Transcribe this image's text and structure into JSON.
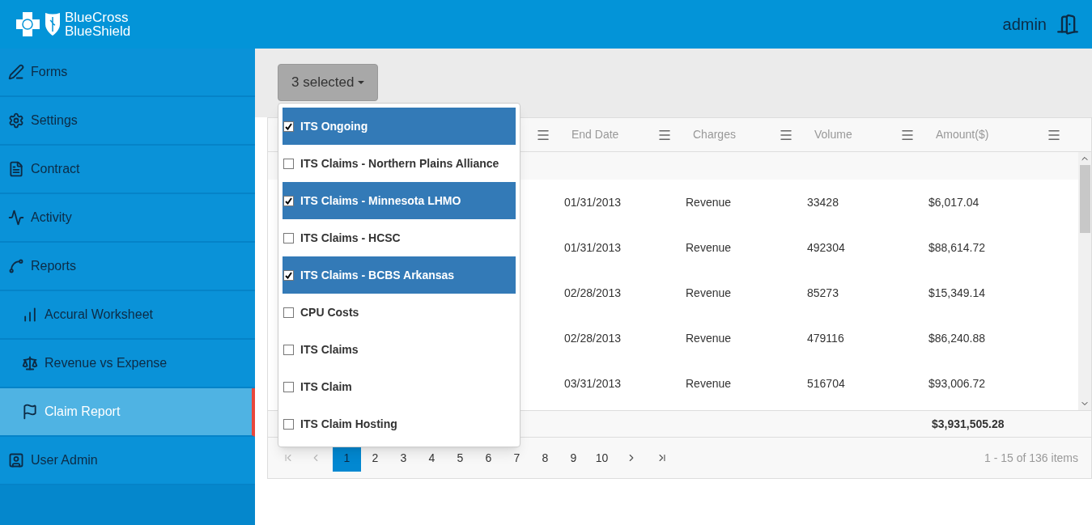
{
  "header": {
    "logo_line1": "BlueCross",
    "logo_line2": "BlueShield",
    "user": "admin"
  },
  "sidebar": {
    "items": [
      {
        "label": "Forms",
        "selected": false
      },
      {
        "label": "Settings",
        "selected": false
      },
      {
        "label": "Contract",
        "selected": false
      },
      {
        "label": "Activity",
        "selected": false
      },
      {
        "label": "Reports",
        "selected": false,
        "children": [
          {
            "label": "Accural Worksheet",
            "selected": false
          },
          {
            "label": "Revenue vs Expense",
            "selected": false
          },
          {
            "label": "Claim Report",
            "selected": true
          }
        ]
      },
      {
        "label": "User Admin",
        "selected": false
      }
    ]
  },
  "filter": {
    "button": "3 selected",
    "expanded": true,
    "options": [
      {
        "label": "ITS Ongoing",
        "checked": true
      },
      {
        "label": "ITS Claims - Northern Plains Alliance",
        "checked": false
      },
      {
        "label": "ITS Claims - Minnesota LHMO",
        "checked": true
      },
      {
        "label": "ITS Claims - HCSC",
        "checked": false
      },
      {
        "label": "ITS Claims - BCBS Arkansas",
        "checked": true
      },
      {
        "label": "CPU Costs",
        "checked": false
      },
      {
        "label": "ITS Claims",
        "checked": false
      },
      {
        "label": "ITS Claim",
        "checked": false
      },
      {
        "label": "ITS Claim Hosting",
        "checked": false
      }
    ]
  },
  "table": {
    "columns": [
      "End Date",
      "Charges",
      "Volume",
      "Amount($)"
    ],
    "rows": [
      [
        "01/31/2013",
        "Revenue",
        "33428",
        "$6,017.04"
      ],
      [
        "01/31/2013",
        "Revenue",
        "492304",
        "$88,614.72"
      ],
      [
        "02/28/2013",
        "Revenue",
        "85273",
        "$15,349.14"
      ],
      [
        "02/28/2013",
        "Revenue",
        "479116",
        "$86,240.88"
      ],
      [
        "03/31/2013",
        "Revenue",
        "516704",
        "$93,006.72"
      ]
    ],
    "total": "$3,931,505.28"
  },
  "pager": {
    "pages": [
      {
        "label": "1",
        "selected": true
      },
      {
        "label": "2",
        "selected": false
      },
      {
        "label": "3",
        "selected": false
      },
      {
        "label": "4",
        "selected": false
      },
      {
        "label": "5",
        "selected": false
      },
      {
        "label": "6",
        "selected": false
      },
      {
        "label": "7",
        "selected": false
      },
      {
        "label": "8",
        "selected": false
      },
      {
        "label": "9",
        "selected": false
      },
      {
        "label": "10",
        "selected": false
      }
    ],
    "info": "1 - 15 of 136 items"
  }
}
